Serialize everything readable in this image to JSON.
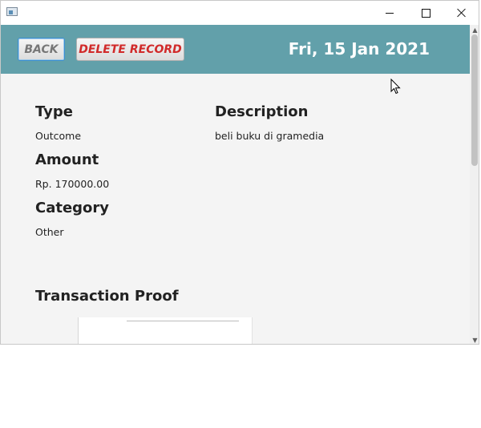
{
  "window": {
    "controls": {
      "minimize": "minimize",
      "maximize": "maximize",
      "close": "close"
    }
  },
  "header": {
    "back_label": "BACK",
    "delete_label": "DELETE RECORD",
    "date": "Fri, 15 Jan 2021",
    "bg_color": "#62a0aa"
  },
  "record": {
    "type_label": "Type",
    "type_value": "Outcome",
    "amount_label": "Amount",
    "amount_value": "Rp. 170000.00",
    "category_label": "Category",
    "category_value": "Other",
    "description_label": "Description",
    "description_value": "beli buku di gramedia",
    "proof_label": "Transaction Proof"
  },
  "colors": {
    "delete_text": "#d12a2a",
    "back_text": "#777777",
    "header_text": "#ffffff"
  }
}
